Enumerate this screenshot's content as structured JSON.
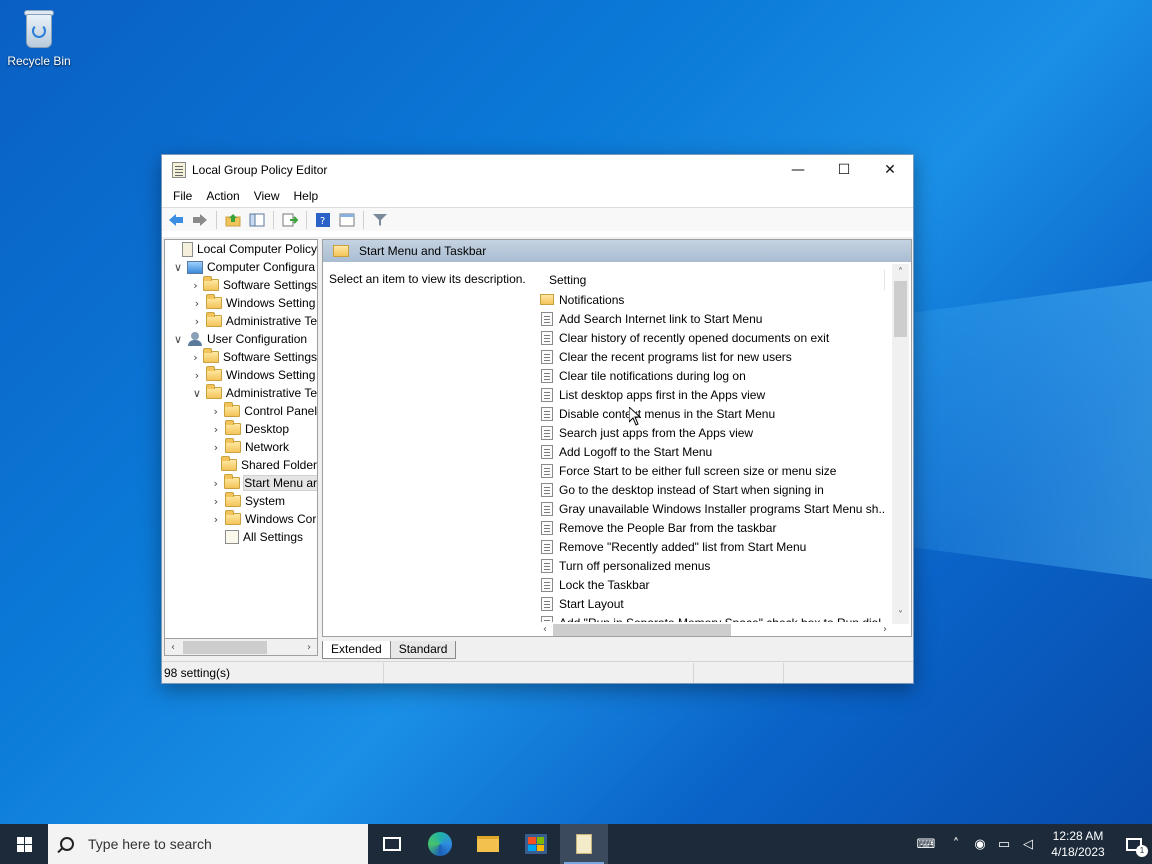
{
  "desktop": {
    "icons": [
      {
        "label": "Recycle Bin",
        "icon": "recycle-bin-icon"
      }
    ]
  },
  "window": {
    "title": "Local Group Policy Editor",
    "controls": {
      "minimize": "—",
      "maximize": "☐",
      "close": "✕"
    },
    "menu": [
      "File",
      "Action",
      "View",
      "Help"
    ],
    "toolbar": [
      "back-icon",
      "forward-icon",
      "up-folder-icon",
      "show-hide-tree-icon",
      "export-list-icon",
      "help-icon",
      "properties-icon",
      "filter-icon"
    ],
    "tree": [
      {
        "label": "Local Computer Policy",
        "indent": 0,
        "expander": "",
        "icon": "policy"
      },
      {
        "label": "Computer Configura",
        "indent": 0,
        "expander": "∨",
        "icon": "pc"
      },
      {
        "label": "Software Settings",
        "indent": 1,
        "expander": "›",
        "icon": "folder"
      },
      {
        "label": "Windows Setting",
        "indent": 1,
        "expander": "›",
        "icon": "folder"
      },
      {
        "label": "Administrative Te",
        "indent": 1,
        "expander": "›",
        "icon": "folder"
      },
      {
        "label": "User Configuration",
        "indent": 0,
        "expander": "∨",
        "icon": "user"
      },
      {
        "label": "Software Settings",
        "indent": 1,
        "expander": "›",
        "icon": "folder"
      },
      {
        "label": "Windows Setting",
        "indent": 1,
        "expander": "›",
        "icon": "folder"
      },
      {
        "label": "Administrative Te",
        "indent": 1,
        "expander": "∨",
        "icon": "folder"
      },
      {
        "label": "Control Panel",
        "indent": 2,
        "expander": "›",
        "icon": "folder"
      },
      {
        "label": "Desktop",
        "indent": 2,
        "expander": "›",
        "icon": "folder"
      },
      {
        "label": "Network",
        "indent": 2,
        "expander": "›",
        "icon": "folder"
      },
      {
        "label": "Shared Folder",
        "indent": 2,
        "expander": "",
        "icon": "folder"
      },
      {
        "label": "Start Menu ar",
        "indent": 2,
        "expander": "›",
        "icon": "folder",
        "selected": true
      },
      {
        "label": "System",
        "indent": 2,
        "expander": "›",
        "icon": "folder"
      },
      {
        "label": "Windows Cor",
        "indent": 2,
        "expander": "›",
        "icon": "folder"
      },
      {
        "label": "All Settings",
        "indent": 2,
        "expander": "",
        "icon": "settings"
      }
    ],
    "right_header": "Start Menu and Taskbar",
    "description": "Select an item to view its description.",
    "column_header": "Setting",
    "settings": [
      {
        "label": "Notifications",
        "type": "folder"
      },
      {
        "label": "Add Search Internet link to Start Menu",
        "type": "policy"
      },
      {
        "label": "Clear history of recently opened documents on exit",
        "type": "policy"
      },
      {
        "label": "Clear the recent programs list for new users",
        "type": "policy"
      },
      {
        "label": "Clear tile notifications during log on",
        "type": "policy"
      },
      {
        "label": "List desktop apps first in the Apps view",
        "type": "policy"
      },
      {
        "label": "Disable context menus in the Start Menu",
        "type": "policy"
      },
      {
        "label": "Search just apps from the Apps view",
        "type": "policy"
      },
      {
        "label": "Add Logoff to the Start Menu",
        "type": "policy"
      },
      {
        "label": "Force Start to be either full screen size or menu size",
        "type": "policy"
      },
      {
        "label": "Go to the desktop instead of Start when signing in",
        "type": "policy"
      },
      {
        "label": "Gray unavailable Windows Installer programs Start Menu sh...",
        "type": "policy"
      },
      {
        "label": "Remove the People Bar from the taskbar",
        "type": "policy"
      },
      {
        "label": "Remove \"Recently added\" list from Start Menu",
        "type": "policy"
      },
      {
        "label": "Turn off personalized menus",
        "type": "policy"
      },
      {
        "label": "Lock the Taskbar",
        "type": "policy"
      },
      {
        "label": "Start Layout",
        "type": "policy"
      },
      {
        "label": "Add \"Run in Separate Memory Space\" check box to Run dial...",
        "type": "policy"
      }
    ],
    "tabs": [
      {
        "label": "Extended",
        "active": true
      },
      {
        "label": "Standard",
        "active": false
      }
    ],
    "status": "98 setting(s)"
  },
  "taskbar": {
    "search_placeholder": "Type here to search",
    "apps": [
      "task-view-icon",
      "edge-icon",
      "file-explorer-icon",
      "store-icon",
      "group-policy-editor-icon"
    ],
    "tray_icons": [
      "keyboard-icon",
      "chevron-up-icon",
      "meet-now-icon",
      "network-icon",
      "volume-muted-icon"
    ],
    "time": "12:28 AM",
    "date": "4/18/2023",
    "notification_count": "1"
  }
}
